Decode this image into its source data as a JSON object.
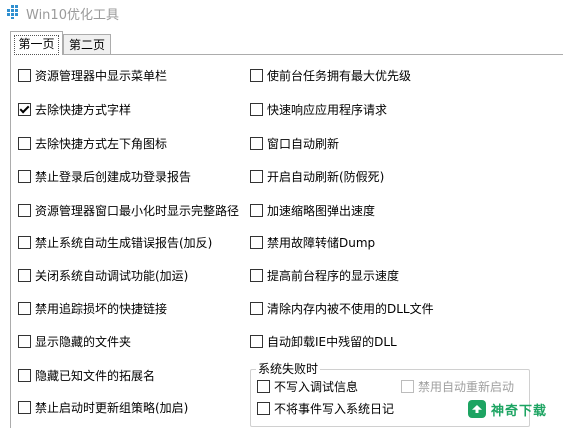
{
  "window": {
    "title": "Win10优化工具",
    "icon": "app-grid-icon",
    "accent": "#2f8fd0"
  },
  "tabs": [
    {
      "label": "第一页",
      "active": true
    },
    {
      "label": "第二页",
      "active": false
    }
  ],
  "left_options": [
    {
      "label": "资源管理器中显示菜单栏",
      "checked": false
    },
    {
      "label": "去除快捷方式字样",
      "checked": true
    },
    {
      "label": "去除快捷方式左下角图标",
      "checked": false
    },
    {
      "label": "禁止登录后创建成功登录报告",
      "checked": false
    },
    {
      "label": "资源管理器窗口最小化时显示完整路径",
      "checked": false
    },
    {
      "label": "禁止系统自动生成错误报告(加反)",
      "checked": false
    },
    {
      "label": "关闭系统自动调试功能(加运)",
      "checked": false
    },
    {
      "label": "禁用追踪损坏的快捷链接",
      "checked": false
    },
    {
      "label": "显示隐藏的文件夹",
      "checked": false
    },
    {
      "label": "隐藏已知文件的拓展名",
      "checked": false
    },
    {
      "label": "禁止启动时更新组策略(加启)",
      "checked": false
    }
  ],
  "right_options": [
    {
      "label": "使前台任务拥有最大优先级",
      "checked": false
    },
    {
      "label": "快速响应应用程序请求",
      "checked": false
    },
    {
      "label": "窗口自动刷新",
      "checked": false
    },
    {
      "label": "开启自动刷新(防假死)",
      "checked": false
    },
    {
      "label": "加速缩略图弹出速度",
      "checked": false
    },
    {
      "label": "禁用故障转储Dump",
      "checked": false
    },
    {
      "label": "提高前台程序的显示速度",
      "checked": false
    },
    {
      "label": "清除内存内被不使用的DLL文件",
      "checked": false
    },
    {
      "label": "自动卸载IE中残留的DLL",
      "checked": false
    }
  ],
  "failure_group": {
    "title": "系统失败时",
    "options": [
      {
        "label": "不写入调试信息",
        "checked": false,
        "enabled": true
      },
      {
        "label": "禁用自动重新启动",
        "checked": false,
        "enabled": false
      },
      {
        "label": "不将事件写入系统日记",
        "checked": false,
        "enabled": true
      }
    ]
  },
  "watermark": {
    "text": "神奇下载",
    "color": "#1da462"
  }
}
